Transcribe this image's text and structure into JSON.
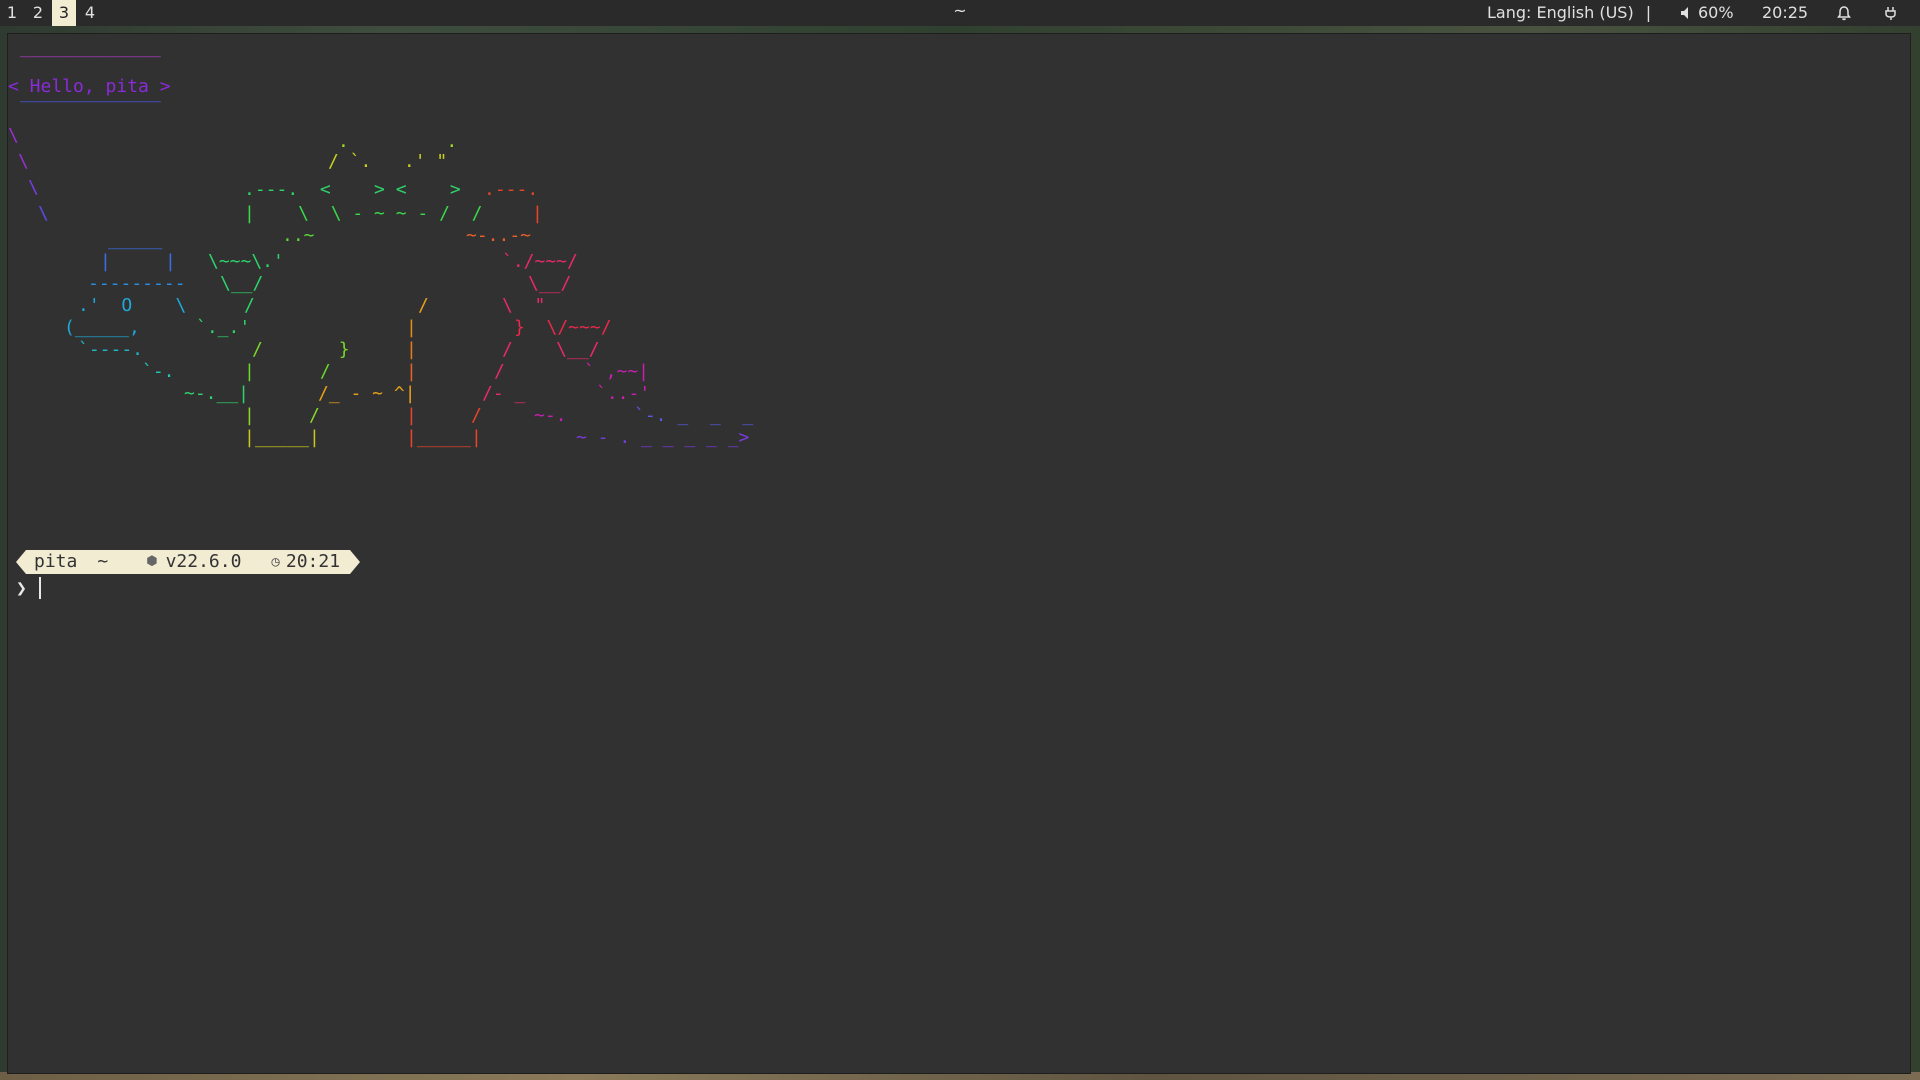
{
  "topbar": {
    "workspaces": [
      {
        "label": "1",
        "active": false
      },
      {
        "label": "2",
        "active": false
      },
      {
        "label": "3",
        "active": true
      },
      {
        "label": "4",
        "active": false
      }
    ],
    "title": "~",
    "lang": "Lang: English (US)",
    "separator": "|",
    "volume": "60%",
    "clock": "20:25"
  },
  "terminal": {
    "greeting": {
      "top": "‾‾‾‾‾‾‾‾‾‾‾‾‾",
      "text": "< Hello, pita >",
      "bottom": "‾‾‾‾‾‾‾‾‾‾‾‾‾",
      "colors": [
        "#b03ac8",
        "#8a2ad8",
        "#4a5ae8"
      ]
    },
    "art_colors": {
      "violet": "#9b2fd0",
      "blue": "#3a6ee8",
      "cyan": "#1fa8d8",
      "green": "#2ed36a",
      "lime": "#8fd82a",
      "yellow": "#d8c41f",
      "orange": "#e88a1a",
      "red": "#e8452a",
      "pink": "#e82a6a",
      "magenta": "#c81fb0"
    },
    "prompt": {
      "user": "pita",
      "dir": "~",
      "node_icon": "⬢",
      "node_version": "v22.6.0",
      "clock_icon": "◷",
      "time": "20:21",
      "symbol": "❯"
    }
  }
}
